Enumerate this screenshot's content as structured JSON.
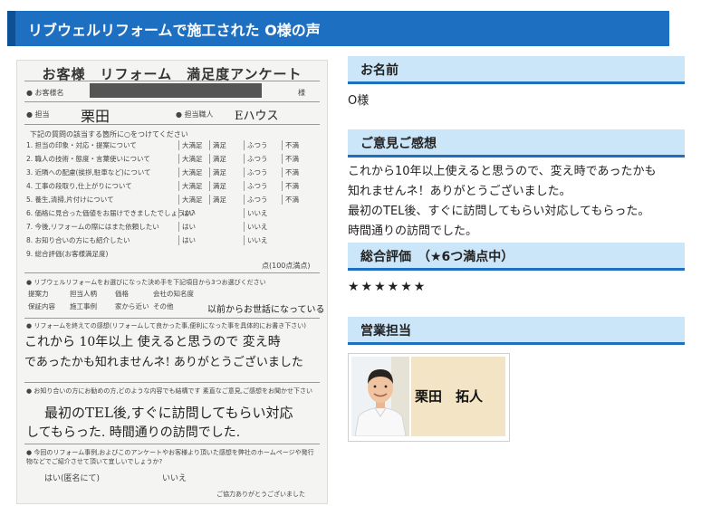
{
  "banner": {
    "title": "リブウェルリフォームで施工された O様の声"
  },
  "survey": {
    "title": "お客様　リフォーム　満足度アンケート",
    "customer_label": "● お客様名",
    "customer_suffix": "様",
    "staff_label": "● 担当",
    "staff_value": "栗田",
    "craftsman_label": "● 担当職人",
    "craftsman_value": "Eハウス",
    "instructions": "下記の質問の該当する箇所に○をつけてください",
    "questions": [
      "1. 担当の印象・対応・提案について",
      "2. 職人の技術・態度・言葉使いについて",
      "3. 近隣への配慮(挨拶,駐車など)について",
      "4. 工事の段取り,仕上がりについて",
      "5. 養生,清掃,片付けについて",
      "6. 価格に見合った価値をお届けできましたでしょうか?",
      "7. 今後,リフォームの際にはまた依頼したい",
      "8. お知り合いの方にも紹介したい",
      "9. 総合評価(お客様満足度)"
    ],
    "scale": [
      "大満足",
      "満足",
      "ふつう",
      "不満"
    ],
    "yesno": [
      "はい",
      "いいえ"
    ],
    "score_note": "点(100点満点)",
    "reasons_label": "● リブウェルリフォームをお選びになった決め手を下記項目から3つお選びください",
    "reasons": [
      "提案力",
      "担当人柄",
      "価格",
      "会社の知名度",
      "保証内容",
      "施工事例",
      "家から近い",
      "その他"
    ],
    "reasons_other": "以前からお世話になっている",
    "impression_label": "● リフォームを終えての感想(リフォームして良かった事,便利になった事を具体的にお書き下さい)",
    "impression_hw_1": "これから 10年以上 使えると思うので 変え時",
    "impression_hw_2": "であったかも知れませんネ! ありがとうございました",
    "feedback_label": "● お知り合いの方にお勧めの方,どのような内容でも結構です 素直なご意見,ご感想をお聞かせ下さい",
    "feedback_hw_1": "最初のTEL後,すぐに訪問してもらい対応",
    "feedback_hw_2": "してもらった. 時間通りの訪問でした.",
    "publish_label": "● 今回のリフォーム事例,およびこのアンケートやお客様より頂いた感想を弊社のホームページや発行物などでご紹介させて頂いて宜しいでしょうか?",
    "publish_yes": "はい(匿名にて)",
    "publish_no": "いいえ",
    "thanks": "ご協力ありがとうございました"
  },
  "name_section": {
    "heading": "お名前",
    "value": "O様"
  },
  "opinion_section": {
    "heading": "ご意見ご感想",
    "line1": "これから10年以上使えると思うので、変え時であったかも",
    "line2": "知れませんネ！ありがとうございました。",
    "line3": "最初のTEL後、すぐに訪問してもらい対応してもらった。",
    "line4": "時間通りの訪問でした。"
  },
  "rating_section": {
    "heading": "総合評価　（★6つ満点中）",
    "stars": "★★★★★★",
    "value": 6,
    "max": 6
  },
  "sales_section": {
    "heading": "営業担当",
    "name": "栗田　拓人"
  },
  "colors": {
    "banner": "#1d6fc1",
    "banner_edge": "#0f4f93",
    "section_bg": "#cbe6f8",
    "section_border": "#1d6fc1",
    "namebox": "#f2e4c4"
  }
}
